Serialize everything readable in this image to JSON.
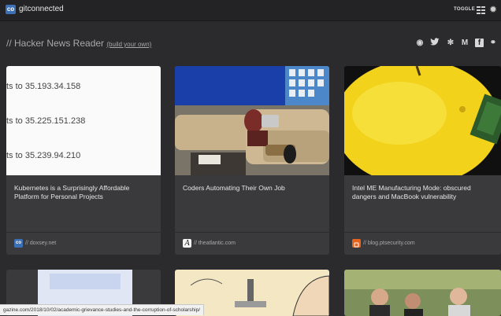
{
  "header": {
    "logo_text": "co",
    "brand": "gitconnected",
    "toggle": "TOGGLE"
  },
  "page": {
    "title": "// Hacker News Reader",
    "build_link": "(build your own)"
  },
  "social": [
    "github-icon",
    "twitter-icon",
    "slack-icon",
    "medium-icon",
    "facebook-icon",
    "link-icon"
  ],
  "social_glyphs": {
    "github": "◉",
    "twitter": "♥",
    "slack": "✻",
    "medium": "M",
    "facebook": "f",
    "link": "⚭"
  },
  "cards": [
    {
      "title": "Kubernetes is a Surprisingly Affordable Platform for Personal Projects",
      "source": "// doxsey.net",
      "ip_rows": [
        "ts to 35.193.34.158",
        "ts to 35.225.151.238",
        "ts to 35.239.94.210"
      ]
    },
    {
      "title": "Coders Automating Their Own Job",
      "source": "// theatlantic.com"
    },
    {
      "title": "Intel ME Manufacturing Mode: obscured dangers and MacBook vulnerability",
      "source": "// blog.ptsecurity.com"
    }
  ],
  "status_url": "gazine.com/2018/10/02/academic-grievance-studies-and-the-corruption-of-scholarship/"
}
